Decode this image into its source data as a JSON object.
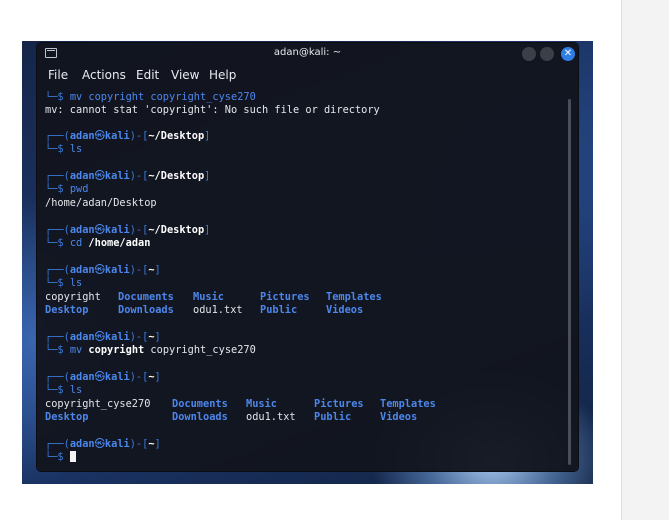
{
  "window": {
    "title": "adan@kali: ~",
    "close_glyph": "✕"
  },
  "menu": [
    "File",
    "Actions",
    "Edit",
    "View",
    "Help"
  ],
  "prompt": {
    "user": "adan",
    "separator": "㉿",
    "host": "kali",
    "symbol": "$"
  },
  "lines": {
    "l0_cmd": "mv copyright copyright_cyse270",
    "l1_output": "mv: cannot stat 'copyright': No such file or directory",
    "p1_path": "~/Desktop",
    "p1_cmd": "ls",
    "p2_path": "~/Desktop",
    "p2_cmd": "pwd",
    "p2_output": "/home/adan/Desktop",
    "p3_path": "~/Desktop",
    "p3_cmd": "cd",
    "p3_arg": "/home/adan",
    "p4_path": "~",
    "p4_cmd": "ls",
    "ls1_row1": [
      "copyright",
      "Documents",
      "Music",
      "Pictures",
      "Templates"
    ],
    "ls1_row2": [
      "Desktop",
      "Downloads",
      "odu1.txt",
      "Public",
      "Videos"
    ],
    "p5_path": "~",
    "p5_cmd": "mv",
    "p5_arg1": "copyright",
    "p5_arg2": "copyright_cyse270",
    "p6_path": "~",
    "p6_cmd": "ls",
    "ls2_row1": [
      "copyright_cyse270",
      "Documents",
      "Music",
      "Pictures",
      "Templates"
    ],
    "ls2_row2": [
      "Desktop",
      "Downloads",
      "odu1.txt",
      "Public",
      "Videos"
    ],
    "p7_path": "~"
  }
}
